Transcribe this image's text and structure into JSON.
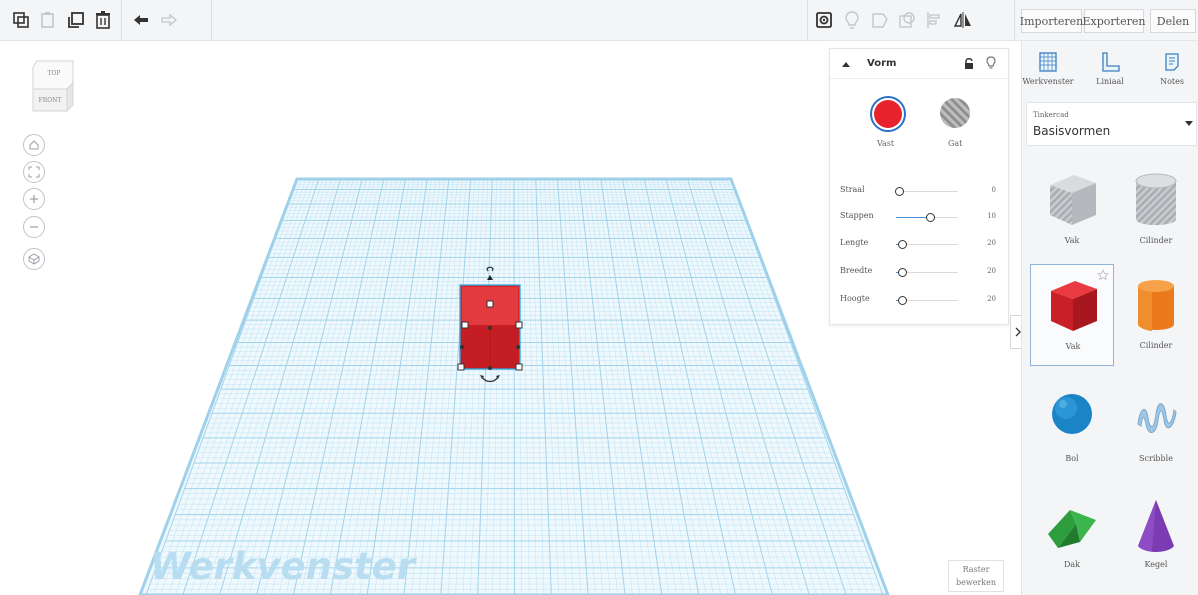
{
  "toolbar": {
    "left_buttons": [
      "copy-icon",
      "paste-icon",
      "duplicate-icon",
      "delete-icon",
      "undo-icon",
      "redo-icon"
    ],
    "right_buttons": [
      "show-all-icon",
      "light-icon",
      "group-icon",
      "ungroup-icon",
      "align-icon",
      "mirror-icon"
    ],
    "import_label": "Importeren",
    "export_label": "Exporteren",
    "share_label": "Delen"
  },
  "view_cube": {
    "top": "TOP",
    "front": "FRONT"
  },
  "nav_controls": [
    "home-view-icon",
    "fit-view-icon",
    "zoom-in-icon",
    "zoom-out-icon",
    "ortho-view-icon"
  ],
  "workplane": {
    "watermark": "Werkvenster",
    "edit_grid_line1": "Raster",
    "edit_grid_line2": "bewerken",
    "grid_color": "#9fd2ea",
    "selected_shape_color": "#e02020"
  },
  "inspector": {
    "title": "Vorm",
    "solid_label": "Vast",
    "hole_label": "Gat",
    "solid_color": "#e8222c",
    "params": [
      {
        "label": "Straal",
        "value": "0",
        "fraction": 0.0
      },
      {
        "label": "Stappen",
        "value": "10",
        "fraction": 0.5
      },
      {
        "label": "Lengte",
        "value": "20",
        "fraction": 0.05
      },
      {
        "label": "Breedte",
        "value": "20",
        "fraction": 0.05
      },
      {
        "label": "Hoogte",
        "value": "20",
        "fraction": 0.05
      }
    ]
  },
  "sidebar": {
    "tools": [
      {
        "label": "Werkvenster",
        "icon": "workplane-icon"
      },
      {
        "label": "Liniaal",
        "icon": "ruler-icon"
      },
      {
        "label": "Notes",
        "icon": "notes-icon"
      }
    ],
    "library_source": "Tinkercad",
    "library_name": "Basisvormen",
    "shapes": [
      {
        "label": "Vak",
        "icon": "box-hole-icon"
      },
      {
        "label": "Cilinder",
        "icon": "cylinder-hole-icon"
      },
      {
        "label": "Vak",
        "icon": "box-icon"
      },
      {
        "label": "Cilinder",
        "icon": "cylinder-icon"
      },
      {
        "label": "Bol",
        "icon": "sphere-icon"
      },
      {
        "label": "Scribble",
        "icon": "scribble-icon"
      },
      {
        "label": "Dak",
        "icon": "roof-icon"
      },
      {
        "label": "Kegel",
        "icon": "cone-icon"
      }
    ]
  }
}
